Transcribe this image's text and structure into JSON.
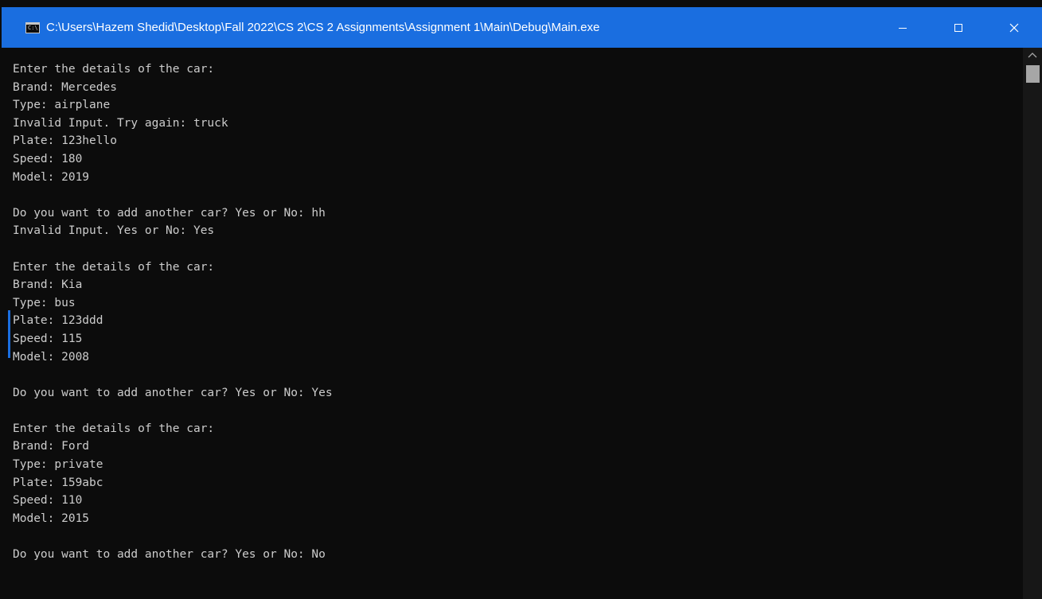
{
  "window": {
    "title": "C:\\Users\\Hazem Shedid\\Desktop\\Fall 2022\\CS 2\\CS 2 Assignments\\Assignment 1\\Main\\Debug\\Main.exe",
    "icon_text": "C:\\",
    "accent_color": "#1a6ee0",
    "buttons": {
      "minimize": "minimize-icon",
      "maximize": "maximize-icon",
      "close": "close-icon"
    }
  },
  "console": {
    "lines": [
      "Enter the details of the car:",
      "Brand: Mercedes",
      "Type: airplane",
      "Invalid Input. Try again: truck",
      "Plate: 123hello",
      "Speed: 180",
      "Model: 2019",
      "",
      "Do you want to add another car? Yes or No: hh",
      "Invalid Input. Yes or No: Yes",
      "",
      "Enter the details of the car:",
      "Brand: Kia",
      "Type: bus",
      "Plate: 123ddd",
      "Speed: 115",
      "Model: 2008",
      "",
      "Do you want to add another car? Yes or No: Yes",
      "",
      "Enter the details of the car:",
      "Brand: Ford",
      "Type: private",
      "Plate: 159abc",
      "Speed: 110",
      "Model: 2015",
      "",
      "Do you want to add another car? Yes or No: No"
    ]
  }
}
